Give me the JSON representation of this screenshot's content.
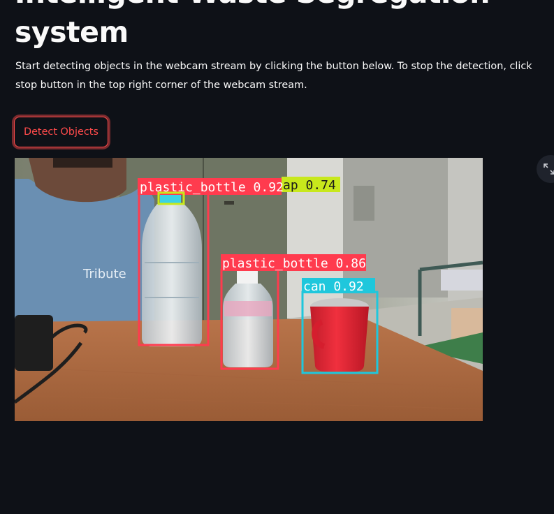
{
  "header": {
    "title_line1": "Intelligent Waste Segregation",
    "title_line2": "system"
  },
  "description": "Start detecting objects in the webcam stream by clicking the button below. To stop the detection, click stop button in the top right corner of the webcam stream.",
  "detect_button_label": "Detect Objects",
  "fullscreen_icon": "expand-icon",
  "stream": {
    "detections": [
      {
        "label": "plastic_bottle",
        "confidence": "0.92",
        "text": "plastic_bottle 0.92",
        "color": "#ff3b4e"
      },
      {
        "label": "cap",
        "confidence": "0.74",
        "text": "ap 0.74",
        "color": "#c8e81c"
      },
      {
        "label": "plastic_bottle",
        "confidence": "0.86",
        "text": "plastic_bottle 0.86",
        "color": "#ff3b4e"
      },
      {
        "label": "can",
        "confidence": "0.92",
        "text": "can 0.92",
        "color": "#1fc7dc"
      }
    ],
    "shirt_text": "Tribute"
  },
  "colors": {
    "background": "#0e1117",
    "accent": "#ff4b4b",
    "text": "#fafafa"
  }
}
